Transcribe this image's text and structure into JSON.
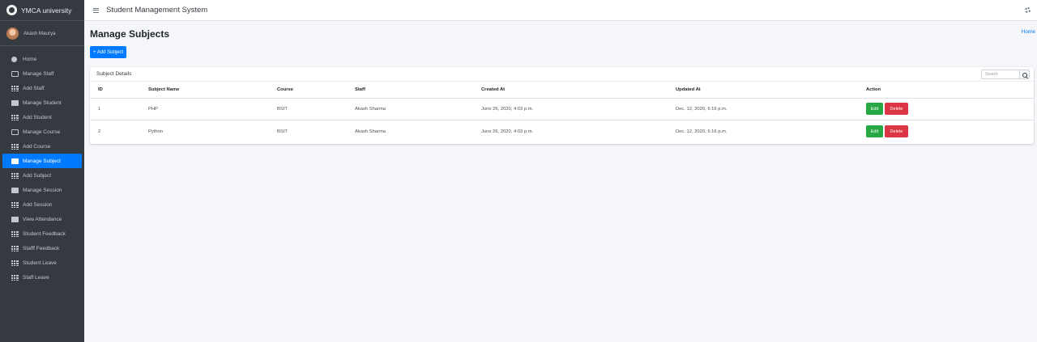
{
  "brand": {
    "name": "YMCA university"
  },
  "user": {
    "name": "Akash Maurya"
  },
  "sidebar": {
    "items": [
      {
        "label": "Home",
        "icon": "dashboard-icon",
        "active": false
      },
      {
        "label": "Manage Staff",
        "icon": "chalkboard-teacher-icon",
        "active": false
      },
      {
        "label": "Add Staff",
        "icon": "table-icon",
        "active": false
      },
      {
        "label": "Manage Student",
        "icon": "user-graduate-icon",
        "active": false
      },
      {
        "label": "Add Student",
        "icon": "table-icon",
        "active": false
      },
      {
        "label": "Manage Course",
        "icon": "desktop-icon",
        "active": false
      },
      {
        "label": "Add Course",
        "icon": "table-icon",
        "active": false
      },
      {
        "label": "Manage Subject",
        "icon": "book-icon",
        "active": true
      },
      {
        "label": "Add Subject",
        "icon": "table-icon",
        "active": false
      },
      {
        "label": "Manage Session",
        "icon": "graduation-cap-icon",
        "active": false
      },
      {
        "label": "Add Session",
        "icon": "table-icon",
        "active": false
      },
      {
        "label": "View Attendance",
        "icon": "calendar-icon",
        "active": false
      },
      {
        "label": "Student Feedback",
        "icon": "table-icon",
        "active": false
      },
      {
        "label": "Stafff Feedback",
        "icon": "table-icon",
        "active": false
      },
      {
        "label": "Student Leave",
        "icon": "table-icon",
        "active": false
      },
      {
        "label": "Staff Leave",
        "icon": "table-icon",
        "active": false
      }
    ]
  },
  "header": {
    "title": "Student Management System"
  },
  "main": {
    "page_title": "Manage Subjects",
    "breadcrumb_home": "Home",
    "add_button": "+ Add Subject",
    "card_title": "Subject Details",
    "search_placeholder": "Search",
    "table": {
      "columns": [
        "ID",
        "Subject Name",
        "Course",
        "Staff",
        "Created At",
        "Updated At",
        "Action"
      ],
      "rows": [
        {
          "id": "1",
          "subject": "PHP",
          "course": "BSIT",
          "staff": "Akash Sharma",
          "created": "June 26, 2020, 4:03 p.m.",
          "updated": "Dec. 12, 2020, 6:16 p.m.",
          "edit": "Edit",
          "delete": "Delete"
        },
        {
          "id": "2",
          "subject": "Python",
          "course": "BSIT",
          "staff": "Akash Sharma",
          "created": "June 26, 2020, 4:03 p.m.",
          "updated": "Dec. 12, 2020, 6:16 p.m.",
          "edit": "Edit",
          "delete": "Delete"
        }
      ]
    }
  },
  "colors": {
    "sidebar_bg": "#343a40",
    "accent": "#007bff",
    "edit": "#28a745",
    "delete": "#dc3545",
    "page_bg": "#f4f6f9"
  }
}
